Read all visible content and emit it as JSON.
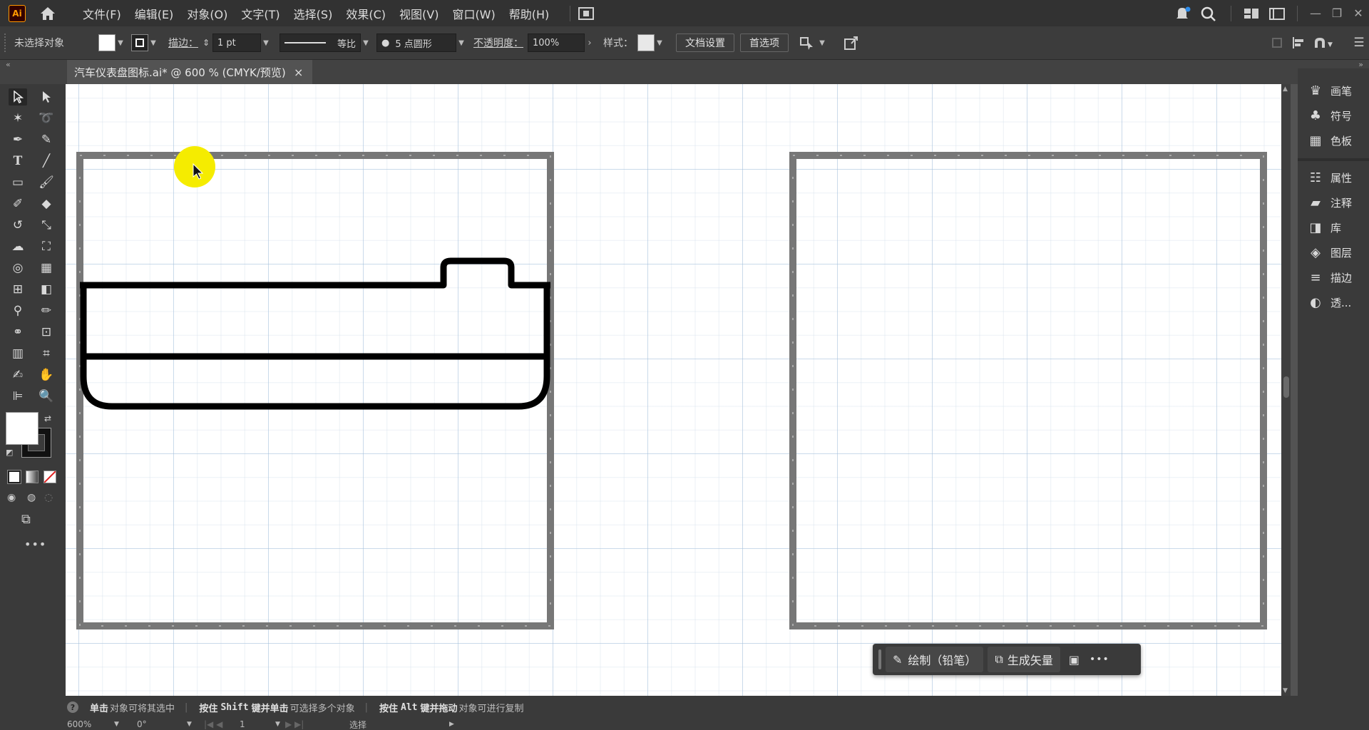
{
  "app": {
    "logo": "Ai",
    "brand_color": "#ff9a00"
  },
  "menu": [
    "文件(F)",
    "编辑(E)",
    "对象(O)",
    "文字(T)",
    "选择(S)",
    "效果(C)",
    "视图(V)",
    "窗口(W)",
    "帮助(H)"
  ],
  "control": {
    "selection": "未选择对象",
    "stroke_label": "描边：",
    "stroke_value": "1 pt",
    "stroke_style": "等比",
    "brush": "5 点圆形",
    "opacity_label": "不透明度：",
    "opacity_value": "100%",
    "style_label": "样式：",
    "doc_setup": "文档设置",
    "prefs": "首选项"
  },
  "tab": {
    "title": "汽车仪表盘图标.ai* @ 600 % (CMYK/预览)",
    "close": "×"
  },
  "panels": [
    "画笔",
    "符号",
    "色板",
    "属性",
    "注释",
    "库",
    "图层",
    "描边",
    "透..."
  ],
  "taskbar": {
    "draw": "绘制（铅笔）",
    "generate": "生成矢量",
    "more": "•••"
  },
  "status": {
    "hint1_bold": "单击",
    "hint1": "对象可将其选中",
    "hint2_pre": "按住",
    "hint2_key": "Shift",
    "hint2_bold": "键并单击",
    "hint2": "可选择多个对象",
    "hint3_pre": "按住",
    "hint3_key": "Alt",
    "hint3_bold": "键并拖动",
    "hint3": "对象可进行复制",
    "zoom": "600%",
    "angle": "0°",
    "artboard": "1",
    "mode": "选择"
  },
  "icons": {
    "tools": [
      "selection-icon",
      "direct-selection-icon",
      "magic-wand-icon",
      "lasso-icon",
      "pen-icon",
      "curvature-icon",
      "type-icon",
      "line-icon",
      "rectangle-icon",
      "paintbrush-icon",
      "shaper-icon",
      "eraser-icon",
      "rotate-icon",
      "scale-icon",
      "warp-icon",
      "free-transform-icon",
      "shape-builder-icon",
      "perspective-icon",
      "mesh-icon",
      "gradient-icon",
      "eyedropper-icon",
      "blend-icon",
      "symbol-sprayer-icon",
      "artboard-icon",
      "graph-icon",
      "slice-icon",
      "pencil-icon",
      "hand-icon",
      "align-icon",
      "zoom-icon"
    ]
  }
}
